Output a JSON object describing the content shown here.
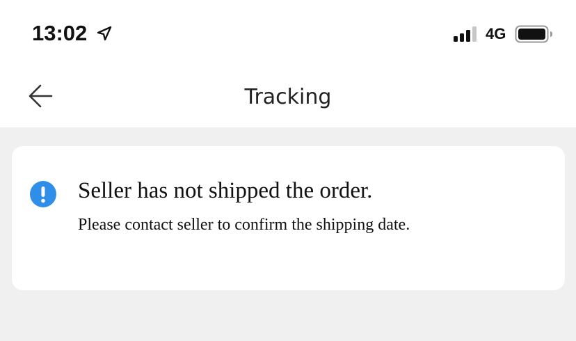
{
  "status_bar": {
    "time": "13:02",
    "location_icon": "location-arrow-icon",
    "signal_icon": "cellular-signal-icon",
    "network": "4G",
    "battery_icon": "battery-icon"
  },
  "nav": {
    "back_icon": "back-arrow-icon",
    "title": "Tracking"
  },
  "notice": {
    "icon": "info-alert-icon",
    "icon_color": "#2f8fe8",
    "title": "Seller has not shipped the order.",
    "message": "Please contact seller to confirm the shipping date."
  },
  "colors": {
    "background": "#f0f0f0",
    "surface": "#ffffff",
    "text": "#111111"
  }
}
